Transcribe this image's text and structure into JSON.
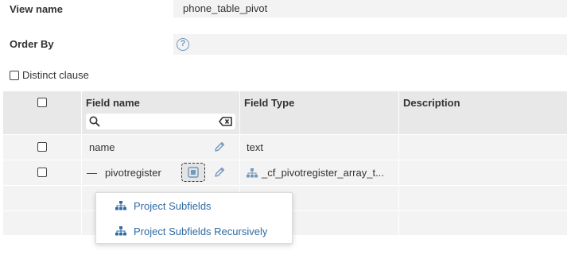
{
  "form": {
    "view_name_label": "View name",
    "view_name_value": "phone_table_pivot",
    "order_by_label": "Order By",
    "order_by_help": "?",
    "distinct_label": "Distinct clause"
  },
  "grid": {
    "headers": {
      "field_name": "Field name",
      "field_type": "Field Type",
      "description": "Description"
    },
    "search_value": "",
    "rows": [
      {
        "name": "name",
        "type": "text",
        "prefix": ""
      },
      {
        "name": "pivotregister",
        "type": "_cf_pivotregister_array_t...",
        "prefix": "—"
      }
    ]
  },
  "menu": {
    "items": [
      {
        "label": "Project Subfields"
      },
      {
        "label": "Project Subfields Recursively"
      }
    ]
  },
  "colors": {
    "accent": "#2f6aa3",
    "icon": "#6f99bd",
    "panel": "#f3f3f3",
    "header": "#e8e8e8"
  }
}
